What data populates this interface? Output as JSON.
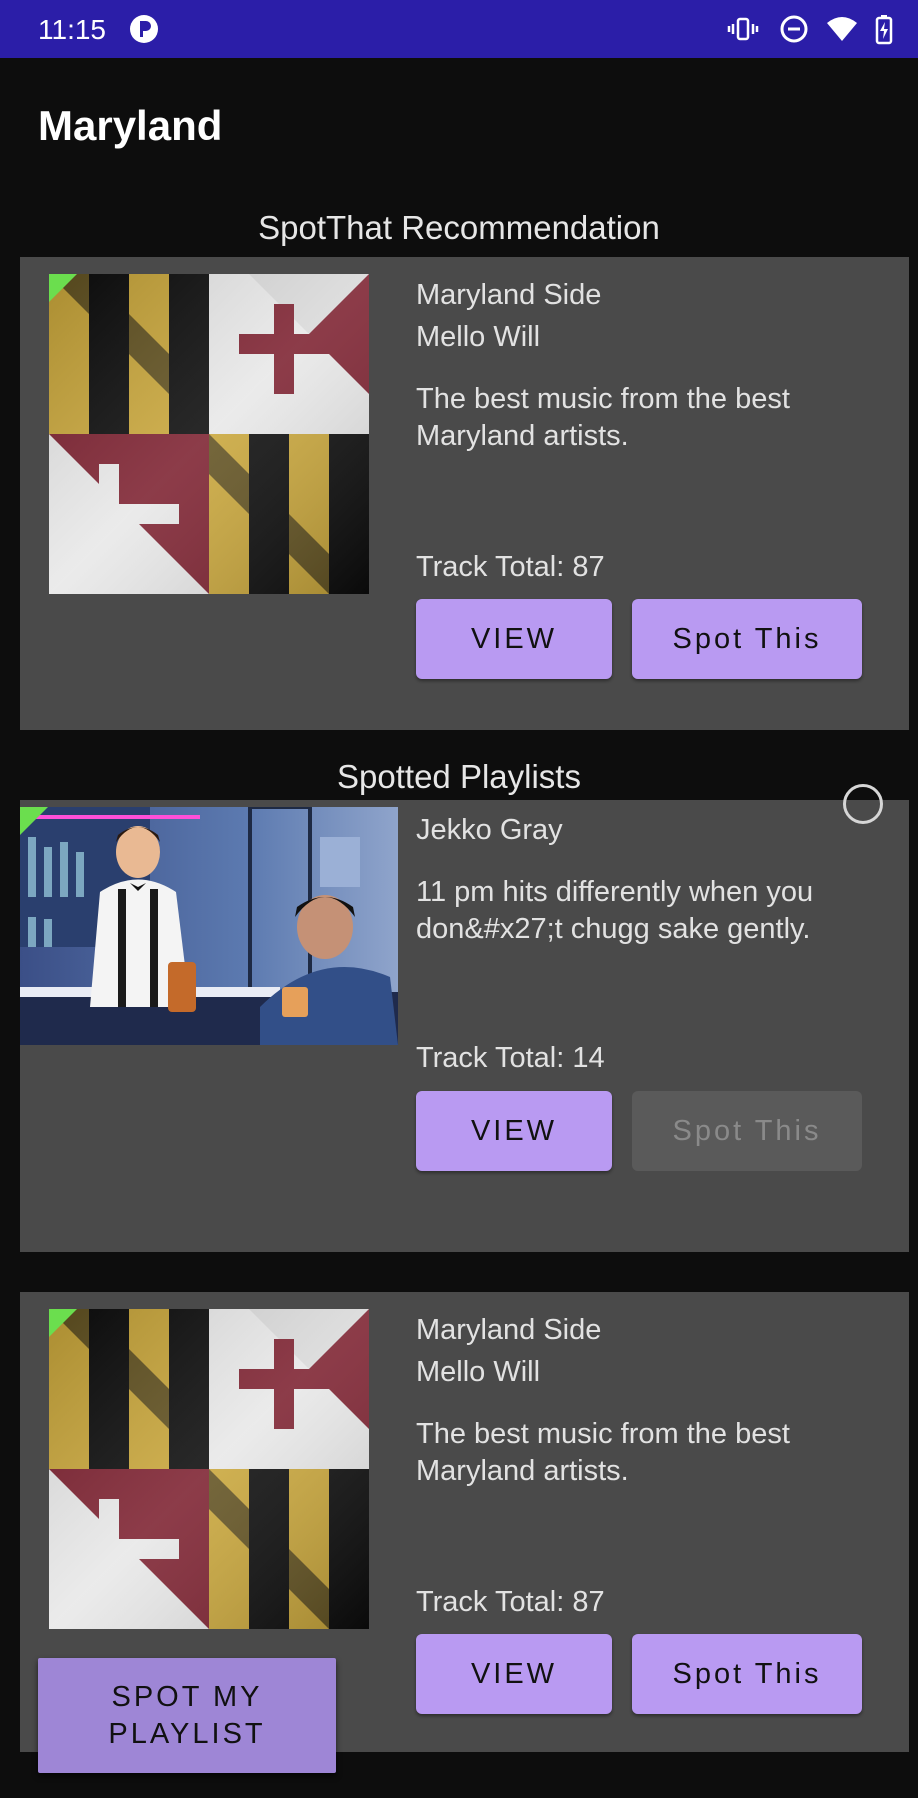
{
  "status_bar": {
    "time": "11:15",
    "icons": [
      "notification-app-icon",
      "vibrate-icon",
      "do-not-disturb-icon",
      "wifi-icon",
      "battery-charging-icon"
    ]
  },
  "app_bar": {
    "title": "Maryland"
  },
  "recommendation": {
    "section_title": "SpotThat Recommendation",
    "card": {
      "name": "Maryland Side",
      "owner": "Mello Will",
      "description": "The best music from the best Maryland artists.",
      "track_total": "Track Total: 87",
      "view_label": "VIEW",
      "spot_label": "Spot This"
    }
  },
  "spotted": {
    "section_title": "Spotted Playlists",
    "cards": [
      {
        "owner": "Jekko Gray",
        "description": "11 pm hits differently when you don&#x27;t chugg sake gently.",
        "track_total": "Track Total: 14",
        "view_label": "VIEW",
        "spot_label": "Spot This",
        "spot_disabled": true
      },
      {
        "name": "Maryland Side",
        "owner": "Mello Will",
        "description": "The best music from the best Maryland artists.",
        "track_total": "Track Total: 87",
        "view_label": "VIEW",
        "spot_label": "Spot This"
      }
    ]
  },
  "fab": {
    "label": "SPOT MY\nPLAYLIST"
  },
  "colors": {
    "status_bar": "#2b1ea8",
    "card": "#4a4a4a",
    "button": "#b99af2",
    "button_disabled": "#5a5a5a",
    "fab": "#9e86d6",
    "background": "#0d0d0d"
  }
}
